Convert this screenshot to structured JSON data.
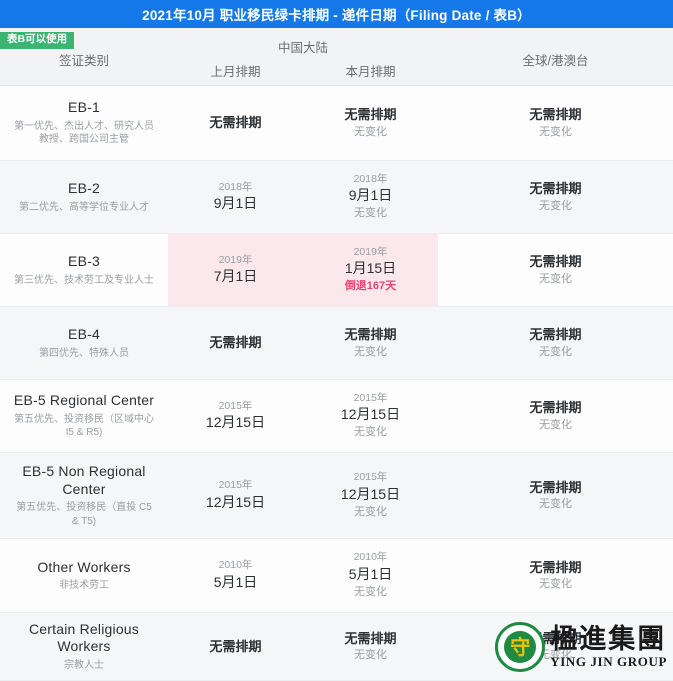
{
  "banner": {
    "title": "2021年10月 职业移民绿卡排期 - 递件日期（Filing Date / 表B）",
    "color": "#1578e8"
  },
  "header": {
    "badge": "表B可以使用",
    "badge_color": "#3ab573",
    "category": "签证类别",
    "china_group": "中国大陆",
    "prev_month": "上月排期",
    "curr_month": "本月排期",
    "worldwide": "全球/港澳台"
  },
  "highlight_color": "#fbe8ec",
  "regress_color": "#e8436f",
  "rows": [
    {
      "title": "EB-1",
      "sub": "第一优先、杰出人才、研究人员\n教授、跨国公司主管",
      "prev": {
        "year": "",
        "day": "无需排期"
      },
      "curr": {
        "year": "",
        "day": "无需排期",
        "note": "无变化"
      },
      "world": {
        "year": "",
        "day": "无需排期",
        "note": "无变化"
      },
      "highlight": false
    },
    {
      "title": "EB-2",
      "sub": "第二优先、高等学位专业人才",
      "prev": {
        "year": "2018年",
        "day": "9月1日"
      },
      "curr": {
        "year": "2018年",
        "day": "9月1日",
        "note": "无变化"
      },
      "world": {
        "year": "",
        "day": "无需排期",
        "note": "无变化"
      },
      "highlight": false
    },
    {
      "title": "EB-3",
      "sub": "第三优先、技术劳工及专业人士",
      "prev": {
        "year": "2019年",
        "day": "7月1日"
      },
      "curr": {
        "year": "2019年",
        "day": "1月15日",
        "note": "倒退167天",
        "note_type": "regress"
      },
      "world": {
        "year": "",
        "day": "无需排期",
        "note": "无变化"
      },
      "highlight": true
    },
    {
      "title": "EB-4",
      "sub": "第四优先、特殊人员",
      "prev": {
        "year": "",
        "day": "无需排期"
      },
      "curr": {
        "year": "",
        "day": "无需排期",
        "note": "无变化"
      },
      "world": {
        "year": "",
        "day": "无需排期",
        "note": "无变化"
      },
      "highlight": false
    },
    {
      "title": "EB-5 Regional Center",
      "sub": "第五优先、投资移民（区域中心\nI5 & R5)",
      "prev": {
        "year": "2015年",
        "day": "12月15日"
      },
      "curr": {
        "year": "2015年",
        "day": "12月15日",
        "note": "无变化"
      },
      "world": {
        "year": "",
        "day": "无需排期",
        "note": "无变化"
      },
      "highlight": false
    },
    {
      "title": "EB-5 Non Regional Center",
      "sub": "第五优先、投资移民（直投 C5\n& T5)",
      "prev": {
        "year": "2015年",
        "day": "12月15日"
      },
      "curr": {
        "year": "2015年",
        "day": "12月15日",
        "note": "无变化"
      },
      "world": {
        "year": "",
        "day": "无需排期",
        "note": "无变化"
      },
      "highlight": false
    },
    {
      "title": "Other Workers",
      "sub": "非技术劳工",
      "prev": {
        "year": "2010年",
        "day": "5月1日"
      },
      "curr": {
        "year": "2010年",
        "day": "5月1日",
        "note": "无变化"
      },
      "world": {
        "year": "",
        "day": "无需排期",
        "note": "无变化"
      },
      "highlight": false
    },
    {
      "title": "Certain Religious Workers",
      "sub": "宗教人士",
      "prev": {
        "year": "",
        "day": "无需排期"
      },
      "curr": {
        "year": "",
        "day": "无需排期",
        "note": "无变化"
      },
      "world": {
        "year": "",
        "day": "无需排期",
        "note": "无变化"
      },
      "highlight": false
    }
  ],
  "logo": {
    "glyph": "守",
    "cn": "楹進集團",
    "en": "YING JIN GROUP",
    "ring_color": "#1f8a43",
    "glyph_color": "#f2c200"
  }
}
